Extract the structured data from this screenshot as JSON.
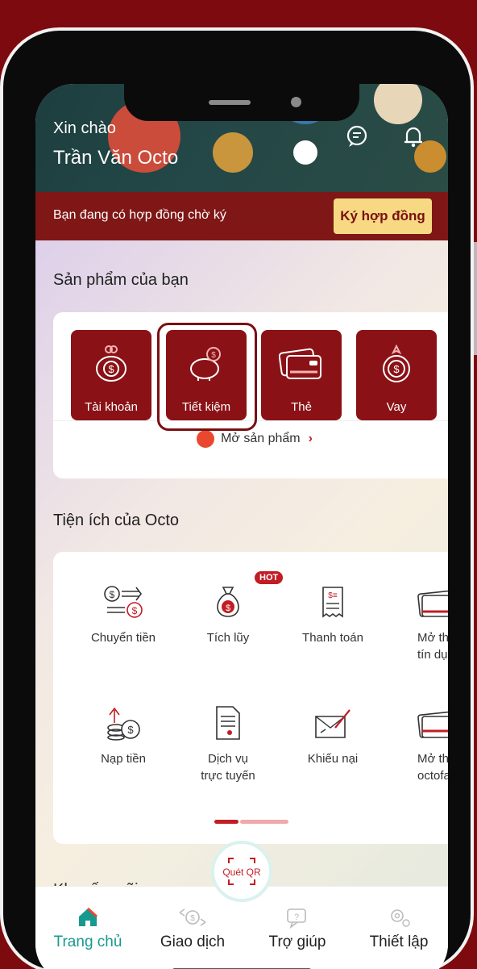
{
  "header": {
    "greeting": "Xin chào",
    "user_name": "Trần Văn Octo"
  },
  "banner": {
    "text": "Bạn đang có hợp đồng chờ ký",
    "button": "Ký hợp đồng"
  },
  "products": {
    "title": "Sản phẩm của bạn",
    "items": [
      {
        "label": "Tài khoản",
        "icon": "money-bag-icon"
      },
      {
        "label": "Tiết kiệm",
        "icon": "piggy-bank-icon"
      },
      {
        "label": "Thẻ",
        "icon": "card-icon"
      },
      {
        "label": "Vay",
        "icon": "loan-icon"
      }
    ],
    "open_label": "Mở sản phẩm"
  },
  "utilities": {
    "title": "Tiện ích của Octo",
    "hot_badge": "HOT",
    "items": [
      {
        "label": "Chuyển tiền",
        "icon": "transfer-icon"
      },
      {
        "label": "Tích lũy",
        "icon": "savings-bag-icon"
      },
      {
        "label": "Thanh toán",
        "icon": "bill-icon"
      },
      {
        "label": "Mở th\ntín dụ",
        "icon": "credit-card-icon"
      },
      {
        "label": "Nạp tiền",
        "icon": "deposit-icon"
      },
      {
        "label": "Dịch vụ\ntrực tuyến",
        "icon": "document-icon"
      },
      {
        "label": "Khiếu nại",
        "icon": "complaint-icon"
      },
      {
        "label": "Mở th\noctofa",
        "icon": "fast-card-icon"
      }
    ]
  },
  "promo_title": "Khuyến mãi",
  "qr": {
    "label": "Quét QR"
  },
  "nav": {
    "items": [
      {
        "label": "Trang chủ",
        "icon": "home-icon"
      },
      {
        "label": "Giao dịch",
        "icon": "transaction-icon"
      },
      {
        "label": "Trợ giúp",
        "icon": "help-icon"
      },
      {
        "label": "Thiết lập",
        "icon": "settings-icon"
      }
    ]
  },
  "colors": {
    "brand_red": "#8a1216",
    "accent_teal": "#17998f",
    "gold": "#f7d983"
  }
}
